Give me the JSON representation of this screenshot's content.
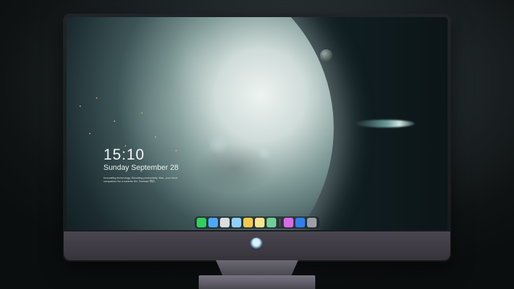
{
  "lock_screen": {
    "time": "15:10",
    "date": "Sunday September 28",
    "tagline": "Innovating technology, Elevating productivity. Mac, your ideal companion for a smarter life. Seesaw 特价"
  },
  "dock": {
    "apps": [
      {
        "name": "messages-icon",
        "color": "#2fd158"
      },
      {
        "name": "finder-icon",
        "color": "#4aa8ff"
      },
      {
        "name": "safari-icon",
        "color": "#d9dde0"
      },
      {
        "name": "preview-icon",
        "color": "#8fd0ff"
      },
      {
        "name": "photos-icon",
        "color": "#f2c94c"
      },
      {
        "name": "notes-icon",
        "color": "#f6e58d"
      },
      {
        "name": "calendar-icon",
        "color": "#6fcf97"
      }
    ],
    "apps_after_sep": [
      {
        "name": "itunes-icon",
        "color": "#d96ce6"
      },
      {
        "name": "app-store-icon",
        "color": "#2f80ed"
      },
      {
        "name": "screenshot-icon",
        "color": "#9aa0a6"
      }
    ]
  }
}
